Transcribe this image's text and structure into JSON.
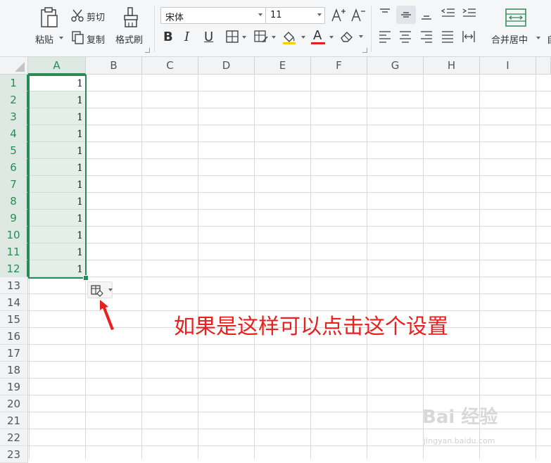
{
  "ribbon": {
    "paste": "粘贴",
    "cut": "剪切",
    "copy": "复制",
    "format_painter": "格式刷",
    "font_name": "宋体",
    "font_size": "11",
    "bold": "B",
    "italic": "I",
    "underline": "U",
    "font_color_letter": "A",
    "merge_center": "合并居中",
    "accent_color": "#2a8a55",
    "fill_color": "#f5d000",
    "font_color": "#e02020"
  },
  "columns": [
    "A",
    "B",
    "C",
    "D",
    "E",
    "F",
    "G",
    "H",
    "I"
  ],
  "rows": [
    "1",
    "2",
    "3",
    "4",
    "5",
    "6",
    "7",
    "8",
    "9",
    "10",
    "11",
    "12",
    "13",
    "14",
    "15",
    "16",
    "17",
    "18",
    "19",
    "20",
    "21",
    "22",
    "23"
  ],
  "column_a_values": [
    "1",
    "1",
    "1",
    "1",
    "1",
    "1",
    "1",
    "1",
    "1",
    "1",
    "1",
    "1"
  ],
  "paste_options_icon": "paste-options-icon",
  "annotation": "如果是这样可以点击这个设置",
  "watermark": "Bai 经验",
  "watermark_sub": "jingyan.baidu.com"
}
